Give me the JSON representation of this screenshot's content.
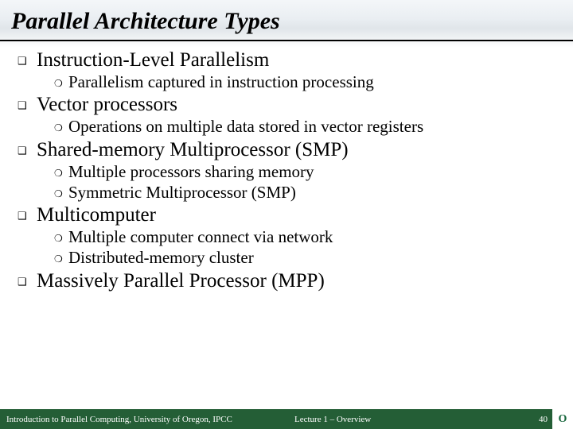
{
  "title": "Parallel Architecture Types",
  "items": [
    {
      "heading": "Instruction-Level Parallelism",
      "subs": [
        "Parallelism captured in instruction processing"
      ]
    },
    {
      "heading": "Vector processors",
      "subs": [
        "Operations on multiple data stored in vector registers"
      ]
    },
    {
      "heading": "Shared-memory Multiprocessor (SMP)",
      "subs": [
        "Multiple processors sharing memory",
        "Symmetric Multiprocessor (SMP)"
      ]
    },
    {
      "heading": "Multicomputer",
      "subs": [
        "Multiple computer connect via network",
        "Distributed-memory cluster"
      ]
    },
    {
      "heading": "Massively Parallel Processor (MPP)",
      "subs": []
    }
  ],
  "footer": {
    "left": "Introduction to Parallel Computing, University of Oregon, IPCC",
    "mid": "Lecture 1 – Overview",
    "page": "40",
    "logo_letter": "O"
  },
  "bullets": {
    "q": "❑",
    "m": "❍"
  }
}
